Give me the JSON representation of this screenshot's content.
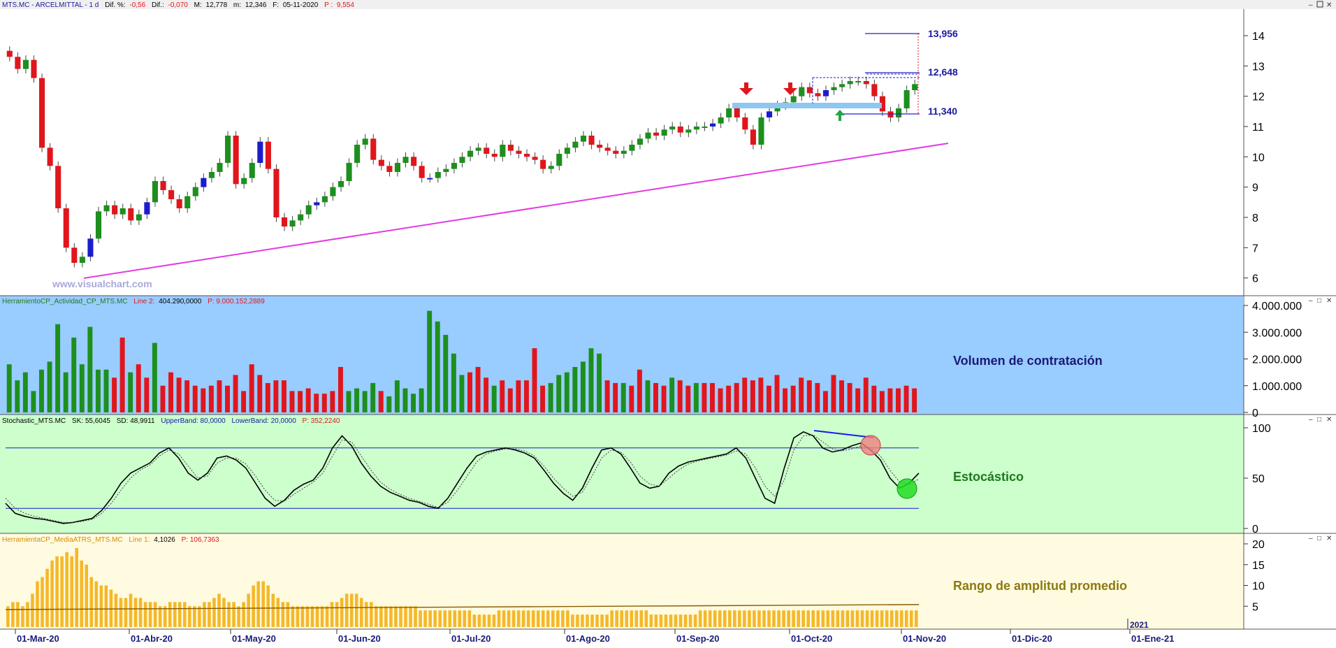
{
  "header": {
    "symbol_name": "MTS.MC - ARCELMITTAL - 1 d",
    "dif_pct_label": "Dif. %:",
    "dif_pct": "-0,56",
    "dif_label": "Dif.:",
    "dif": "-0,070",
    "max_label": "M:",
    "max": "12,778",
    "min_label": "m:",
    "min": "12,346",
    "date_label": "F:",
    "date": "05-11-2020",
    "price_label": "P :",
    "price": "9,554"
  },
  "watermark": "www.visualchart.com",
  "panels": {
    "volume": {
      "legend_name": "HerramientoCP_Actividad_CP_MTS.MC",
      "legend_value_label": "Line 2:",
      "legend_value": "404.290,0000",
      "legend_p": "P: 9.000.152,2889",
      "caption": "Volumen de contratación"
    },
    "stochastic": {
      "legend_name": "Stochastic_MTS.MC",
      "legend_sk": "SK: 55,6045",
      "legend_sd": "SD: 48,9911",
      "legend_upper": "UpperBand: 80,0000",
      "legend_lower": "LowerBand: 20,0000",
      "legend_p": "P: 352,2240",
      "caption": "Estocástico"
    },
    "atr": {
      "legend_name": "HerramientaCP_MediaATRS_MTS.MC",
      "legend_value_label": "Line 1:",
      "legend_value": "4,1026",
      "legend_p": "P: 106,7363",
      "caption": "Rango de amplitud promedio"
    }
  },
  "colors": {
    "up_candle": "#1d8f1d",
    "down_candle": "#e0161c",
    "blue_candle": "#1c1ccf",
    "trendline": "#e23be2",
    "support_zone": "#8ec7f2",
    "level_line": "#2020c8",
    "volume_bg": "#99ccff",
    "stoch_bg": "#ccffcc",
    "atr_bg": "#fffbe0",
    "atr_bar": "#f5b82a",
    "arrow_down": "#e0161c",
    "arrow_up": "#22a34a"
  },
  "chart_data": [
    {
      "type": "candlestick",
      "title": "MTS.MC - ARCELMITTAL - 1 d",
      "ylim": [
        5.6,
        14.6
      ],
      "y_ticks": [
        "6",
        "7",
        "8",
        "9",
        "10",
        "11",
        "12",
        "13",
        "14"
      ],
      "x_labels": [
        "01-Mar-20",
        "01-Abr-20",
        "01-May-20",
        "01-Jun-20",
        "01-Jul-20",
        "01-Ago-20",
        "01-Sep-20",
        "01-Oct-20",
        "01-Nov-20",
        "01-Dic-20",
        "01-Ene-21"
      ],
      "x_year_marker": "2021",
      "annotations": {
        "level_labels": [
          "13,956",
          "12,648",
          "11,340"
        ],
        "levels": [
          13.956,
          12.648,
          11.34
        ],
        "trendline": {
          "from": [
            6.0,
            "01-Mar-20 +24d"
          ],
          "to": [
            10.45,
            "01-Nov-20 +4d"
          ]
        },
        "support_zone": [
          11.6,
          11.75
        ],
        "resistance_zone": [
          12.1,
          12.55
        ]
      },
      "closes": [
        13.3,
        12.9,
        13.2,
        12.6,
        10.3,
        9.7,
        8.3,
        7.0,
        6.5,
        6.7,
        7.3,
        8.2,
        8.4,
        8.1,
        8.3,
        7.9,
        8.1,
        8.5,
        9.2,
        8.9,
        8.6,
        8.3,
        8.7,
        9.0,
        9.3,
        9.5,
        9.8,
        10.7,
        9.1,
        9.3,
        9.8,
        10.5,
        9.6,
        8.0,
        7.7,
        7.9,
        8.1,
        8.4,
        8.5,
        8.7,
        9.0,
        9.2,
        9.8,
        10.4,
        10.6,
        9.9,
        9.7,
        9.5,
        9.8,
        10.0,
        9.7,
        9.3,
        9.3,
        9.5,
        9.6,
        9.8,
        10.0,
        10.2,
        10.3,
        10.1,
        10.0,
        10.4,
        10.2,
        10.1,
        10.0,
        9.9,
        9.6,
        9.7,
        10.1,
        10.3,
        10.5,
        10.7,
        10.4,
        10.3,
        10.2,
        10.1,
        10.2,
        10.4,
        10.6,
        10.8,
        10.7,
        10.9,
        11.0,
        10.8,
        10.9,
        11.0,
        11.0,
        11.1,
        11.3,
        11.6,
        11.3,
        10.9,
        10.4,
        11.3,
        11.5,
        11.7,
        11.8,
        12.0,
        12.3,
        12.1,
        12.0,
        12.2,
        12.3,
        12.4,
        12.5,
        12.5,
        12.4,
        12.0,
        11.5,
        11.3,
        11.6,
        12.2,
        12.4
      ],
      "opens": [
        13.5,
        13.3,
        12.9,
        13.2,
        12.6,
        10.3,
        9.7,
        8.3,
        7.0,
        6.5,
        6.7,
        7.3,
        8.2,
        8.4,
        8.1,
        8.3,
        7.9,
        8.1,
        8.5,
        9.2,
        8.9,
        8.6,
        8.3,
        8.7,
        9.0,
        9.3,
        9.5,
        9.8,
        10.7,
        9.1,
        9.3,
        9.8,
        10.5,
        9.6,
        8.0,
        7.7,
        7.9,
        8.1,
        8.4,
        8.5,
        8.7,
        9.0,
        9.2,
        9.8,
        10.4,
        10.6,
        9.9,
        9.7,
        9.5,
        9.8,
        10.0,
        9.7,
        9.3,
        9.3,
        9.5,
        9.6,
        9.8,
        10.0,
        10.2,
        10.3,
        10.1,
        10.0,
        10.4,
        10.2,
        10.1,
        10.0,
        9.9,
        9.6,
        9.7,
        10.1,
        10.3,
        10.5,
        10.7,
        10.4,
        10.3,
        10.2,
        10.1,
        10.2,
        10.4,
        10.6,
        10.8,
        10.7,
        10.9,
        11.0,
        10.8,
        10.9,
        11.0,
        11.0,
        11.1,
        11.3,
        11.6,
        11.3,
        10.9,
        10.4,
        11.3,
        11.5,
        11.7,
        11.8,
        12.0,
        12.3,
        12.1,
        12.0,
        12.2,
        12.3,
        12.4,
        12.5,
        12.5,
        12.4,
        12.0,
        11.5,
        11.3,
        11.6,
        12.2
      ]
    },
    {
      "type": "bar",
      "ylabel": "",
      "ylim": [
        0,
        4000000
      ],
      "y_ticks": [
        "0",
        "1.000.000",
        "2.000.000",
        "3.000.000",
        "4.000.000"
      ],
      "values": [
        1.8,
        1.2,
        1.5,
        0.8,
        1.6,
        1.9,
        3.3,
        1.5,
        2.8,
        1.8,
        3.2,
        1.6,
        1.6,
        1.3,
        2.8,
        1.5,
        1.8,
        1.3,
        2.6,
        1.0,
        1.5,
        1.3,
        1.2,
        1.0,
        0.9,
        1.0,
        1.2,
        1.0,
        1.4,
        0.8,
        1.8,
        1.4,
        1.1,
        1.2,
        1.2,
        0.8,
        0.8,
        0.9,
        0.7,
        0.7,
        0.8,
        1.7,
        0.8,
        0.9,
        0.8,
        1.1,
        0.8,
        0.6,
        1.2,
        0.9,
        0.7,
        0.9,
        3.8,
        3.4,
        2.9,
        2.2,
        1.4,
        1.5,
        1.7,
        1.3,
        1.0,
        1.2,
        0.9,
        1.2,
        1.2,
        2.4,
        1.0,
        1.1,
        1.4,
        1.5,
        1.7,
        1.9,
        2.4,
        2.2,
        1.2,
        1.1,
        1.1,
        1.0,
        1.6,
        1.2,
        1.1,
        1.0,
        1.3,
        1.2,
        1.0,
        1.1,
        1.1,
        1.1,
        0.9,
        1.0,
        1.1,
        1.3,
        1.2,
        1.3,
        1.0,
        1.4,
        0.9,
        1.0,
        1.3,
        1.2,
        1.1,
        0.8,
        1.4,
        1.2,
        1.1,
        0.9,
        1.3,
        1.0,
        0.8,
        0.9,
        0.9,
        1.0,
        0.9
      ],
      "value_unit": "millions",
      "colors": [
        "up",
        "up",
        "up",
        "up",
        "up",
        "up",
        "up",
        "up",
        "up",
        "up",
        "up",
        "up",
        "up",
        "down",
        "down",
        "up",
        "down",
        "down",
        "up",
        "down",
        "down",
        "down",
        "down",
        "down",
        "down",
        "down",
        "down",
        "down",
        "down",
        "down",
        "down",
        "down",
        "down",
        "down",
        "down",
        "down",
        "down",
        "down",
        "down",
        "down",
        "down",
        "down",
        "up",
        "up",
        "up",
        "up",
        "down",
        "up",
        "up",
        "up",
        "up",
        "up",
        "up",
        "up",
        "up",
        "up",
        "up",
        "down",
        "down",
        "down",
        "up",
        "down",
        "down",
        "down",
        "down",
        "down",
        "down",
        "up",
        "up",
        "up",
        "up",
        "up",
        "up",
        "up",
        "down",
        "down",
        "up",
        "down",
        "down",
        "up",
        "down",
        "down",
        "up",
        "down",
        "down",
        "up",
        "down",
        "down",
        "down",
        "down",
        "down",
        "down",
        "down",
        "down",
        "down",
        "down",
        "down",
        "down",
        "down",
        "down",
        "down",
        "down",
        "down",
        "down",
        "down",
        "down",
        "down",
        "down",
        "down",
        "down",
        "down",
        "down",
        "down"
      ]
    },
    {
      "type": "line",
      "ylim": [
        0,
        100
      ],
      "y_ticks": [
        "0",
        "50",
        "100"
      ],
      "bands": [
        80,
        20
      ],
      "series": [
        {
          "name": "SK",
          "values": [
            25,
            15,
            12,
            10,
            9,
            7,
            5,
            6,
            8,
            10,
            18,
            30,
            45,
            55,
            60,
            65,
            75,
            80,
            70,
            55,
            48,
            55,
            70,
            72,
            68,
            60,
            45,
            30,
            22,
            28,
            38,
            44,
            48,
            60,
            80,
            92,
            82,
            65,
            52,
            42,
            36,
            32,
            28,
            26,
            22,
            20,
            30,
            45,
            60,
            72,
            76,
            78,
            80,
            78,
            75,
            70,
            58,
            45,
            35,
            28,
            40,
            60,
            78,
            80,
            74,
            60,
            45,
            40,
            42,
            55,
            62,
            66,
            68,
            70,
            72,
            74,
            80,
            70,
            50,
            30,
            25,
            60,
            90,
            96,
            92,
            80,
            76,
            78,
            82,
            85,
            78,
            68,
            50,
            40,
            45,
            55
          ]
        },
        {
          "name": "SD",
          "values": [
            30,
            20,
            15,
            12,
            10,
            8,
            6,
            6,
            7,
            9,
            15,
            25,
            38,
            50,
            58,
            63,
            72,
            78,
            74,
            62,
            50,
            52,
            65,
            70,
            70,
            64,
            52,
            38,
            28,
            27,
            34,
            40,
            46,
            55,
            72,
            88,
            86,
            72,
            58,
            46,
            39,
            34,
            30,
            27,
            24,
            21,
            26,
            38,
            52,
            66,
            74,
            77,
            79,
            79,
            77,
            72,
            62,
            50,
            40,
            32,
            36,
            52,
            70,
            78,
            76,
            66,
            52,
            44,
            42,
            50,
            58,
            64,
            67,
            69,
            71,
            73,
            77,
            74,
            60,
            42,
            32,
            48,
            78,
            92,
            93,
            86,
            79,
            77,
            79,
            82,
            80,
            72,
            58,
            46,
            44,
            49
          ]
        }
      ]
    },
    {
      "type": "bar",
      "ylim": [
        0,
        20
      ],
      "y_ticks": [
        "5",
        "10",
        "15",
        "20"
      ],
      "values": [
        5,
        6,
        6,
        5,
        6,
        8,
        11,
        12,
        14,
        16,
        17,
        17,
        18,
        17,
        19,
        16,
        15,
        12,
        11,
        10,
        10,
        9,
        8,
        7,
        7,
        8,
        7,
        7,
        6,
        6,
        6,
        5,
        5,
        6,
        6,
        6,
        6,
        5,
        5,
        5,
        6,
        6,
        7,
        8,
        7,
        6,
        6,
        5,
        6,
        8,
        10,
        11,
        11,
        10,
        8,
        7,
        6,
        6,
        5,
        5,
        5,
        5,
        5,
        5,
        5,
        5,
        6,
        6,
        7,
        8,
        8,
        8,
        7,
        6,
        6,
        5,
        5,
        5,
        5,
        5,
        5,
        5,
        5,
        5,
        4,
        4,
        4,
        4,
        4,
        4,
        4,
        4,
        4,
        4,
        4,
        3,
        3,
        3,
        3,
        3,
        4,
        4,
        4,
        4,
        4,
        4,
        4,
        4,
        4,
        4,
        4,
        4,
        4,
        4,
        4,
        3,
        3,
        3,
        3,
        3,
        3,
        3,
        3,
        4,
        4,
        4,
        4,
        4,
        4,
        4,
        4,
        3,
        3,
        3,
        3,
        3,
        3,
        3,
        3,
        3,
        3,
        4,
        4,
        4,
        4,
        4,
        4,
        4,
        4,
        4,
        4,
        4,
        4,
        4,
        4,
        4,
        4,
        4,
        4,
        4,
        4,
        4,
        4,
        4,
        4,
        4,
        4,
        4,
        4,
        4,
        4,
        4,
        4,
        4,
        4,
        4,
        4,
        4,
        4,
        4,
        4,
        4,
        4,
        4,
        4,
        4
      ],
      "series_average": 4.1026
    }
  ]
}
